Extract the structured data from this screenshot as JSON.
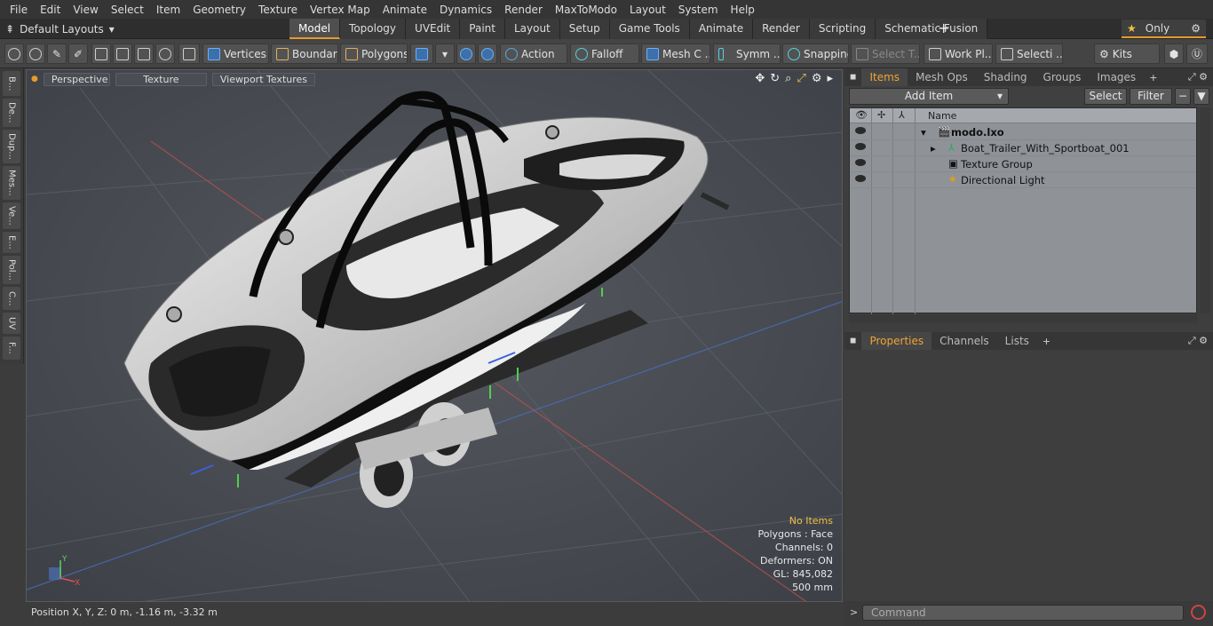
{
  "menu": [
    "File",
    "Edit",
    "View",
    "Select",
    "Item",
    "Geometry",
    "Texture",
    "Vertex Map",
    "Animate",
    "Dynamics",
    "Render",
    "MaxToModo",
    "Layout",
    "System",
    "Help"
  ],
  "layout_selector": "Default Layouts",
  "tabs": [
    "Model",
    "Topology",
    "UVEdit",
    "Paint",
    "Layout",
    "Setup",
    "Game Tools",
    "Animate",
    "Render",
    "Scripting",
    "Schematic Fusion"
  ],
  "active_tab": "Model",
  "only_label": "Only",
  "toolbar": {
    "vertices": "Vertices",
    "boundary": "Boundary",
    "polygons": "Polygons",
    "action": "Action",
    "falloff": "Falloff",
    "mesh": "Mesh C ...",
    "symm": "Symm ...",
    "snapping": "Snapping",
    "select_t": "Select T...",
    "work_pl": "Work Pl...",
    "selecti": "Selecti ...",
    "kits": "Kits"
  },
  "left_tabs": [
    "B...",
    "De...",
    "Dup...",
    "Mes...",
    "Ve...",
    "E...",
    "Pol...",
    "C...",
    "UV",
    "F..."
  ],
  "viewport": {
    "view_mode": "Perspective",
    "shading": "Texture",
    "textures": "Viewport Textures",
    "info": {
      "no_items": "No Items",
      "polygons": "Polygons : Face",
      "channels": "Channels: 0",
      "deformers": "Deformers: ON",
      "gl": "GL: 845,082",
      "scale": "500 mm"
    },
    "axis_labels": {
      "y": "Y",
      "x": "X"
    }
  },
  "status": {
    "position": "Position X, Y, Z:   0 m, -1.16 m, -3.32 m"
  },
  "panel_top_tabs": [
    "Items",
    "Mesh Ops",
    "Shading",
    "Groups",
    "Images"
  ],
  "items_controls": {
    "add_item": "Add Item",
    "select": "Select",
    "filter": "Filter"
  },
  "tree": {
    "column_name": "Name",
    "rows": [
      {
        "label": "modo.lxo"
      },
      {
        "label": "Boat_Trailer_With_Sportboat_001"
      },
      {
        "label": "Texture Group"
      },
      {
        "label": "Directional Light"
      }
    ]
  },
  "panel_bottom_tabs": [
    "Properties",
    "Channels",
    "Lists"
  ],
  "command": {
    "placeholder": "Command"
  },
  "colors": {
    "accent": "#e89a2a",
    "viewport_bg": "#4a5058",
    "tree_bg": "#8f9398"
  }
}
